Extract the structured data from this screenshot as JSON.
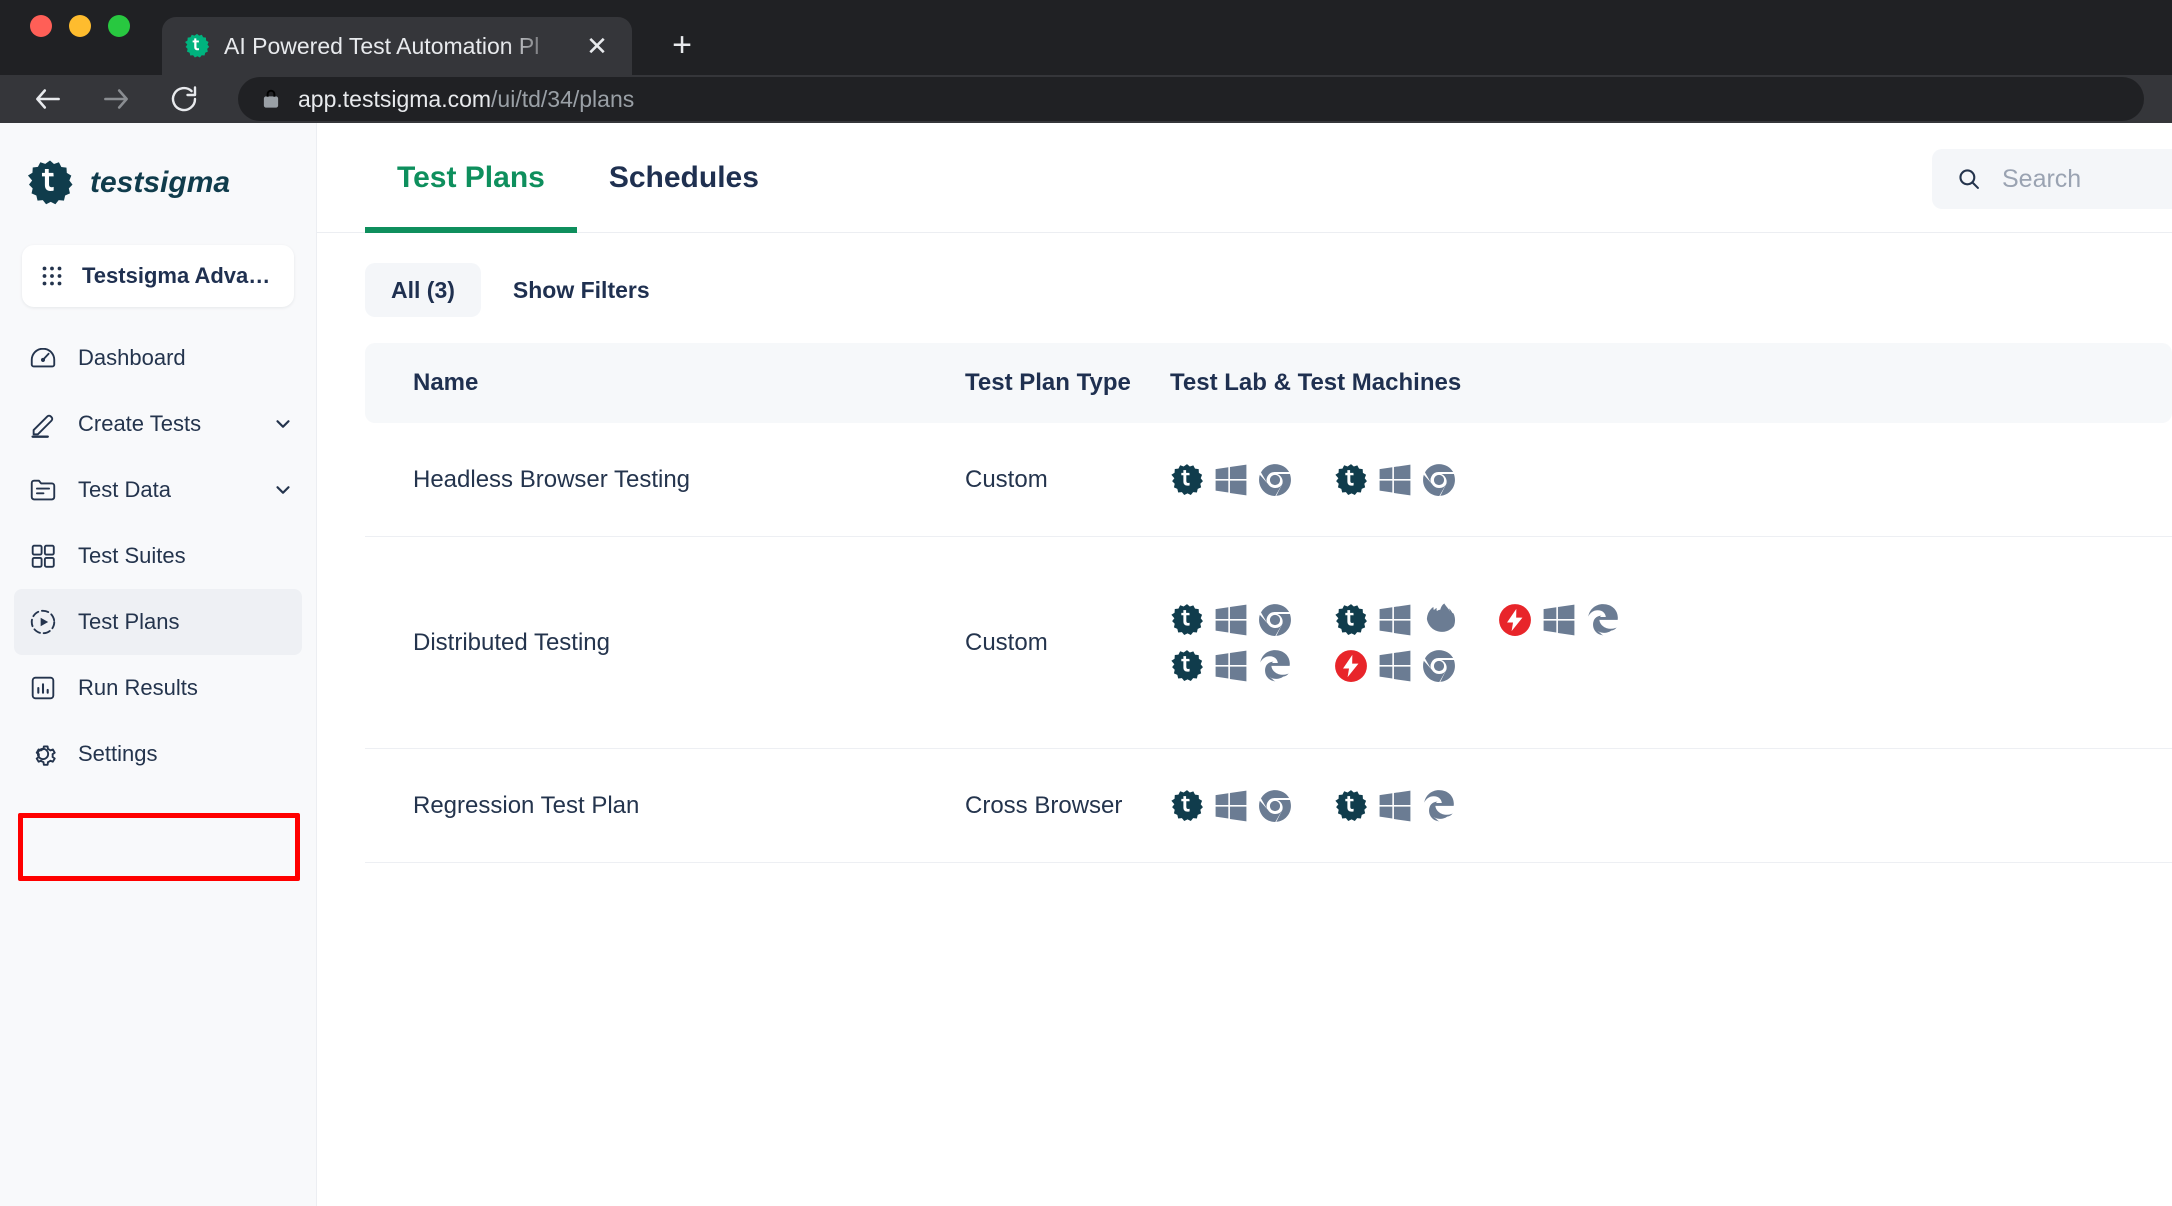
{
  "browser": {
    "tab": {
      "title": "AI Powered Test Automation Pl",
      "favicon_icon": "testsigma-gear-icon",
      "close_icon": "close-icon"
    },
    "new_tab_icon": "plus-icon",
    "nav": {
      "back_icon": "arrow-left-icon",
      "forward_icon": "arrow-right-icon",
      "reload_icon": "reload-icon"
    },
    "omnibox": {
      "lock_icon": "lock-icon",
      "url_host": "app.testsigma.com",
      "url_path": "/ui/td/34/plans"
    }
  },
  "sidebar": {
    "logo": {
      "mark_icon": "testsigma-gear-icon",
      "wordmark": "testsigma"
    },
    "project": {
      "grid_icon": "app-grid-icon",
      "name": "Testsigma Advanced..."
    },
    "items": [
      {
        "label": "Dashboard",
        "icon": "gauge-icon",
        "has_chevron": false,
        "active": false
      },
      {
        "label": "Create Tests",
        "icon": "pencil-icon",
        "has_chevron": true,
        "active": false
      },
      {
        "label": "Test Data",
        "icon": "folder-list-icon",
        "has_chevron": true,
        "active": false
      },
      {
        "label": "Test Suites",
        "icon": "grid-squares-icon",
        "has_chevron": false,
        "active": false
      },
      {
        "label": "Test Plans",
        "icon": "play-circle-icon",
        "has_chevron": false,
        "active": true
      },
      {
        "label": "Run Results",
        "icon": "bar-chart-icon",
        "has_chevron": false,
        "active": false
      },
      {
        "label": "Settings",
        "icon": "gear-icon",
        "has_chevron": false,
        "active": false
      }
    ],
    "highlight_color": "#ff0000",
    "highlight_target": "Test Plans"
  },
  "main": {
    "tabs": [
      {
        "label": "Test Plans",
        "active": true
      },
      {
        "label": "Schedules",
        "active": false
      }
    ],
    "accent_color": "#0e8f5d",
    "search": {
      "icon": "search-icon",
      "placeholder": "Search"
    },
    "filters": {
      "all_chip": "All (3)",
      "show_filters": "Show Filters"
    },
    "table": {
      "headers": {
        "name": "Name",
        "type": "Test Plan Type",
        "lab": "Test Lab & Test Machines"
      },
      "rows": [
        {
          "name": "Headless Browser Testing",
          "type": "Custom",
          "machine_lines": [
            [
              {
                "lab_icon": "testsigma-lab-icon",
                "os_icon": "windows-icon",
                "browser_icon": "chrome-icon"
              },
              {
                "lab_icon": "testsigma-lab-icon",
                "os_icon": "windows-icon",
                "browser_icon": "chrome-icon"
              }
            ]
          ]
        },
        {
          "name": "Distributed Testing",
          "type": "Custom",
          "machine_lines": [
            [
              {
                "lab_icon": "testsigma-lab-icon",
                "os_icon": "windows-icon",
                "browser_icon": "chrome-icon"
              },
              {
                "lab_icon": "testsigma-lab-icon",
                "os_icon": "windows-icon",
                "browser_icon": "firefox-icon"
              },
              {
                "lab_icon": "lambdatest-icon",
                "os_icon": "windows-icon",
                "browser_icon": "edge-icon"
              }
            ],
            [
              {
                "lab_icon": "testsigma-lab-icon",
                "os_icon": "windows-icon",
                "browser_icon": "edge-icon"
              },
              {
                "lab_icon": "lambdatest-icon",
                "os_icon": "windows-icon",
                "browser_icon": "chrome-icon"
              }
            ]
          ]
        },
        {
          "name": "Regression Test Plan",
          "type": "Cross Browser",
          "machine_lines": [
            [
              {
                "lab_icon": "testsigma-lab-icon",
                "os_icon": "windows-icon",
                "browser_icon": "chrome-icon"
              },
              {
                "lab_icon": "testsigma-lab-icon",
                "os_icon": "windows-icon",
                "browser_icon": "edge-icon"
              }
            ]
          ]
        }
      ]
    }
  },
  "colors": {
    "brand_dark": "#103c4c",
    "accent_green": "#0e8f5d",
    "text_navy": "#1f3050",
    "icon_slate": "#6b7c93",
    "lambdatest_red": "#e8252a",
    "highlight_red": "#ff0000"
  }
}
